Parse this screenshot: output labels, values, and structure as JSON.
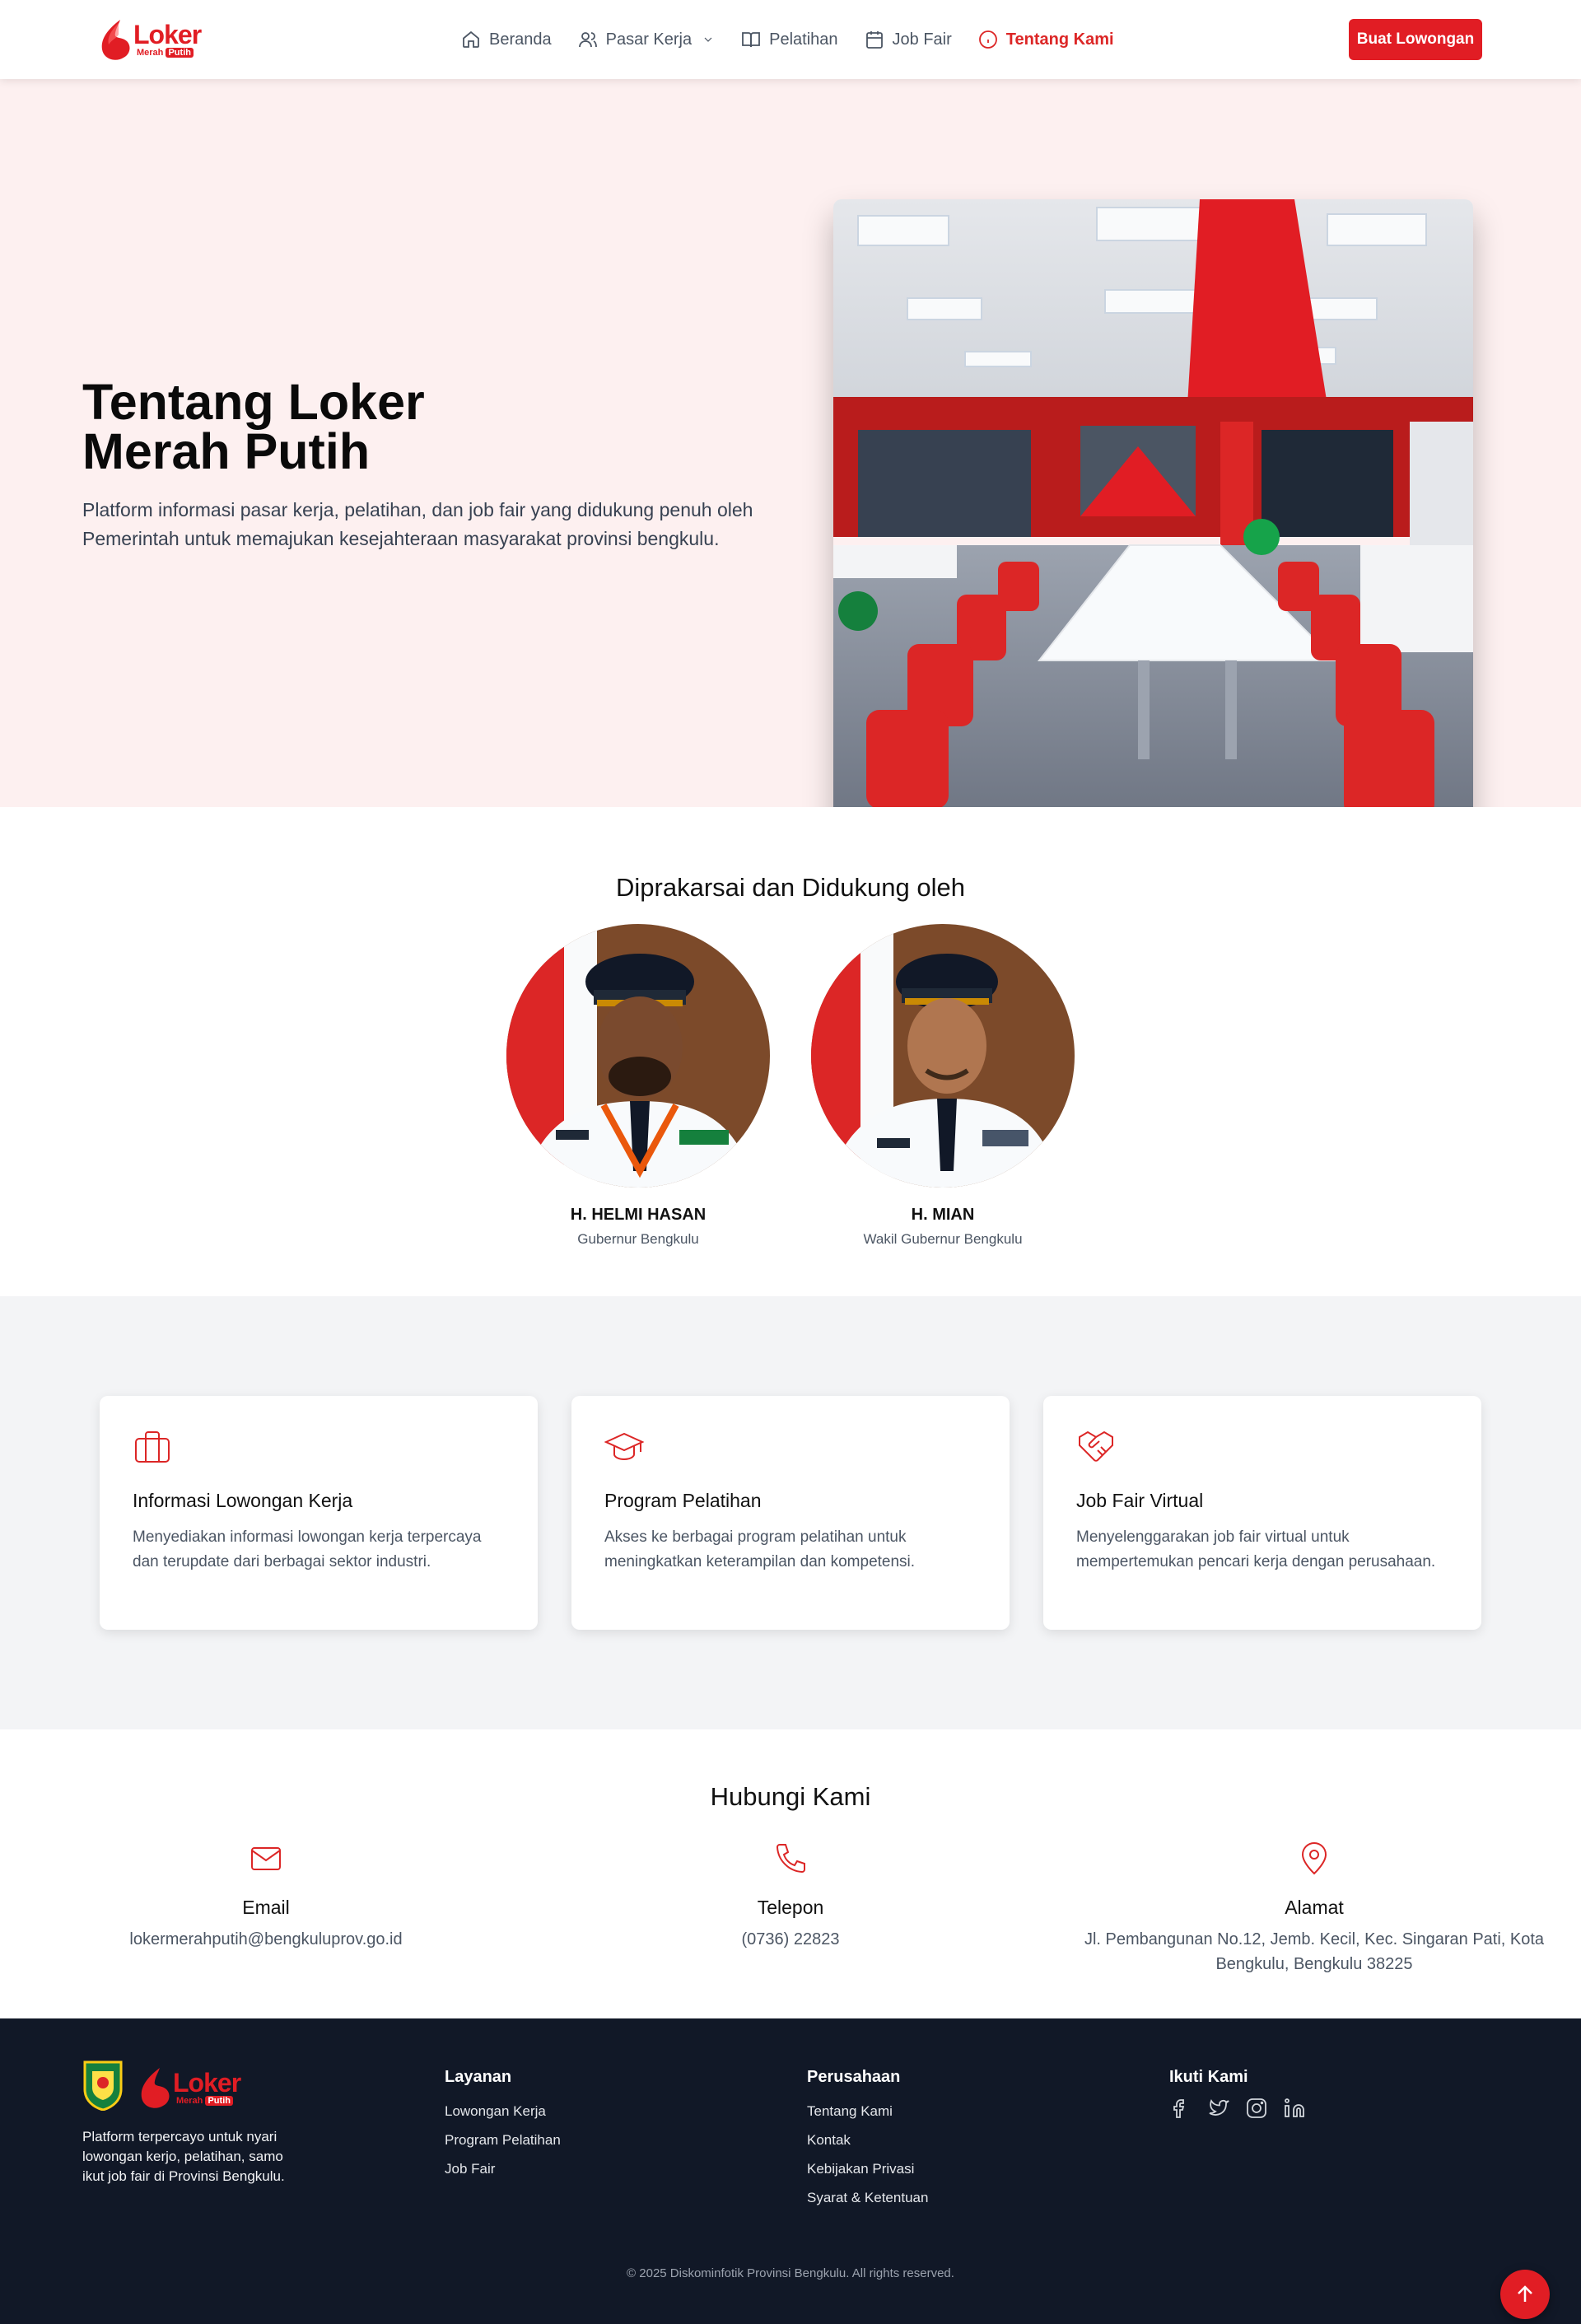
{
  "brand": {
    "logo_word": "Loker",
    "logo_sub_a": "Merah",
    "logo_sub_b": "Putih",
    "primary_color": "#e11d24"
  },
  "nav": {
    "items": [
      {
        "label": "Beranda",
        "icon": "home-icon"
      },
      {
        "label": "Pasar Kerja",
        "icon": "users-icon"
      },
      {
        "label": "Pelatihan",
        "icon": "book-icon"
      },
      {
        "label": "Job Fair",
        "icon": "calendar-icon"
      },
      {
        "label": "Tentang Kami",
        "icon": "info-icon"
      }
    ],
    "active": "Tentang Kami",
    "cta_label": "Buat Lowongan"
  },
  "hero": {
    "title_line1": "Tentang Loker",
    "title_line2": "Merah Putih",
    "description": "Platform informasi pasar kerja, pelatihan, dan job fair yang didukung penuh oleh Pemerintah untuk memajukan kesejahteraan masyarakat provinsi bengkulu."
  },
  "supporters": {
    "title": "Diprakarsai dan Didukung oleh",
    "people": [
      {
        "name": "H. HELMI HASAN",
        "role": "Gubernur Bengkulu"
      },
      {
        "name": "H. MIAN",
        "role": "Wakil Gubernur Bengkulu"
      }
    ]
  },
  "features": [
    {
      "icon": "briefcase-icon",
      "title": "Informasi Lowongan Kerja",
      "description": "Menyediakan informasi lowongan kerja terpercaya dan terupdate dari berbagai sektor industri."
    },
    {
      "icon": "graduation-cap-icon",
      "title": "Program Pelatihan",
      "description": "Akses ke berbagai program pelatihan untuk meningkatkan keterampilan dan kompetensi."
    },
    {
      "icon": "handshake-icon",
      "title": "Job Fair Virtual",
      "description": "Menyelenggarakan job fair virtual untuk mempertemukan pencari kerja dengan perusahaan."
    }
  ],
  "contact": {
    "title": "Hubungi Kami",
    "items": [
      {
        "icon": "mail-icon",
        "label": "Email",
        "value": "lokermerahputih@bengkuluprov.go.id"
      },
      {
        "icon": "phone-icon",
        "label": "Telepon",
        "value": "(0736) 22823"
      },
      {
        "icon": "map-pin-icon",
        "label": "Alamat",
        "value": "Jl. Pembangunan No.12, Jemb. Kecil, Kec. Singaran Pati, Kota Bengkulu, Bengkulu 38225"
      }
    ]
  },
  "footer": {
    "tagline": "Platform terpercayo untuk nyari lowongan kerjo, pelatihan, samo ikut job fair di Provinsi Bengkulu.",
    "layanan": {
      "title": "Layanan",
      "links": [
        "Lowongan Kerja",
        "Program Pelatihan",
        "Job Fair"
      ]
    },
    "perusahaan": {
      "title": "Perusahaan",
      "links": [
        "Tentang Kami",
        "Kontak",
        "Kebijakan Privasi",
        "Syarat & Ketentuan"
      ]
    },
    "ikuti": {
      "title": "Ikuti Kami",
      "socials": [
        "facebook-icon",
        "twitter-icon",
        "instagram-icon",
        "linkedin-icon"
      ]
    },
    "copyright": "© 2025 Diskominfotik Provinsi Bengkulu. All rights reserved."
  }
}
